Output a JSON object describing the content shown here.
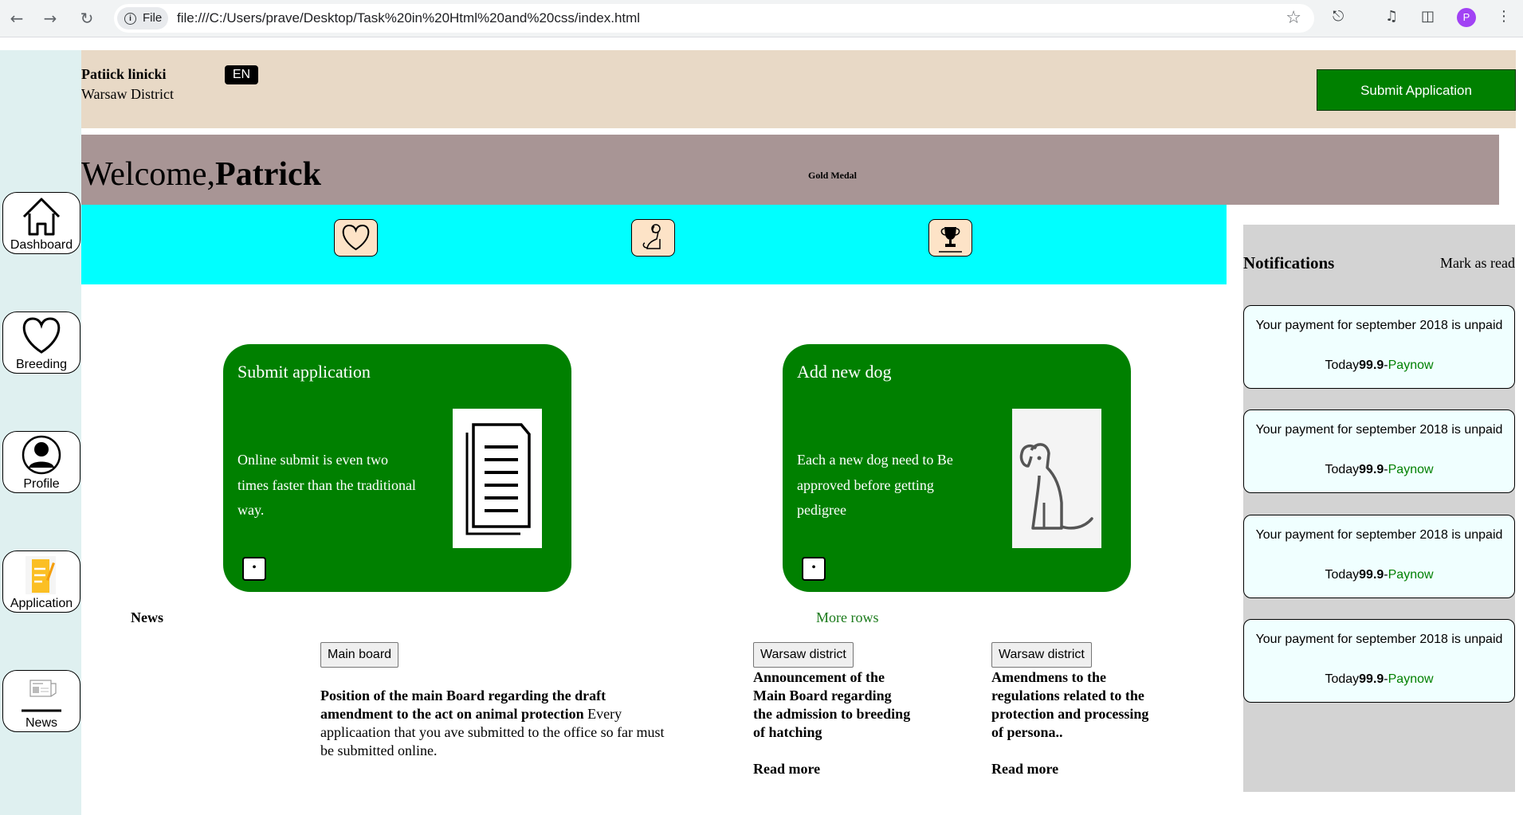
{
  "browser": {
    "scheme_label": "File",
    "url": "file:///C:/Users/prave/Desktop/Task%20in%20Html%20and%20css/index.html",
    "profile_initial": "P"
  },
  "sidebar": {
    "items": [
      {
        "label": "Dashboard",
        "icon": "home-icon"
      },
      {
        "label": "Breeding",
        "icon": "heart-icon"
      },
      {
        "label": "Profile",
        "icon": "user-icon"
      },
      {
        "label": "Application",
        "icon": "application-form-icon"
      },
      {
        "label": "News",
        "icon": "newspaper-icon"
      }
    ]
  },
  "header": {
    "user_name": "Patiick linicki",
    "district": "Warsaw District",
    "language": "EN",
    "submit_label": "Submit Application"
  },
  "welcome": {
    "greeting": "Welcome,",
    "name": "Patrick",
    "medal": "Gold Medal"
  },
  "quick_icons": [
    "heart-icon",
    "dog-icon",
    "trophy-icon"
  ],
  "cards": [
    {
      "title": "Submit application",
      "description": "Online submit is even two times faster than the traditional way.",
      "icon": "document-icon"
    },
    {
      "title": "Add new dog",
      "description": "Each a new dog need to Be approved before getting pedigree",
      "icon": "dog-icon"
    }
  ],
  "news": {
    "label": "News",
    "more_rows": "More rows",
    "items": [
      {
        "tag": "Main board",
        "title": "Position of the main Board regarding the draft amendment to the act on animal protection",
        "body": " Every applicaation that you ave submitted to the office so far must be submitted online."
      },
      {
        "tag": "Warsaw district",
        "title": "Announcement of the Main Board regarding the admission to breeding of hatching",
        "read_more": "Read more"
      },
      {
        "tag": "Warsaw district",
        "title": "Amendmens to the regulations related to the protection and processing of persona..",
        "read_more": "Read more"
      }
    ]
  },
  "notifications": {
    "title": "Notifications",
    "mark_read": "Mark as read",
    "items": [
      {
        "message": "Your payment for september 2018 is unpaid",
        "date": "Today",
        "amount": "99.9",
        "separator": "-",
        "action": "Paynow"
      },
      {
        "message": "Your payment for september 2018 is unpaid",
        "date": "Today",
        "amount": "99.9",
        "separator": "-",
        "action": "Paynow"
      },
      {
        "message": "Your payment for september 2018 is unpaid",
        "date": "Today",
        "amount": "99.9",
        "separator": "-",
        "action": "Paynow"
      },
      {
        "message": "Your payment for september 2018 is unpaid",
        "date": "Today",
        "amount": "99.9",
        "separator": "-",
        "action": "Paynow"
      }
    ]
  },
  "colors": {
    "accent_green": "#008000",
    "header_bg": "#e8d9c6",
    "welcome_bg": "#a89595",
    "band_cyan": "#00ffff",
    "sidebar_bg": "#dff0f0",
    "notification_bg": "#d3d3d3"
  }
}
